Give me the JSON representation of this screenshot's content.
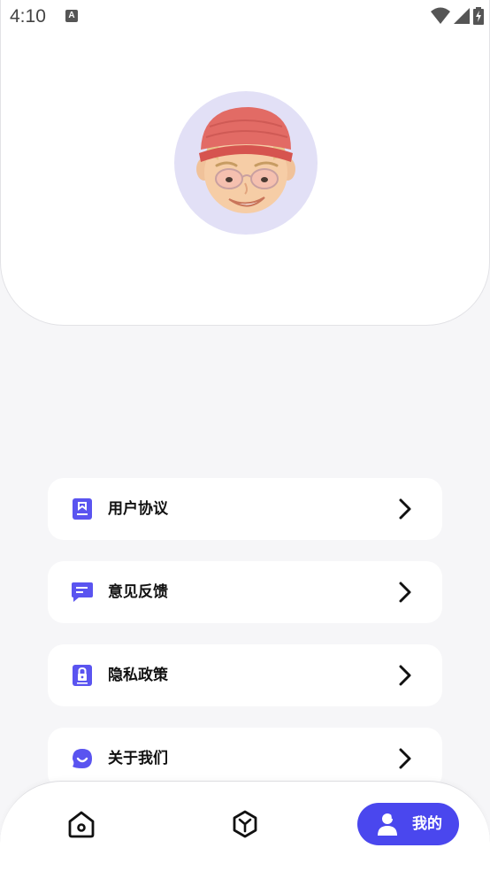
{
  "status_bar": {
    "time": "4:10",
    "notification_letter": "A"
  },
  "menu": [
    {
      "label": "用户协议",
      "icon": "document-icon"
    },
    {
      "label": "意见反馈",
      "icon": "message-icon"
    },
    {
      "label": "隐私政策",
      "icon": "lock-icon"
    },
    {
      "label": "关于我们",
      "icon": "smile-icon"
    }
  ],
  "bottom_nav": {
    "active_label": "我的"
  },
  "colors": {
    "accent": "#4a47ee",
    "background": "#f6f6f8",
    "avatar_bg": "#e2e0f6"
  }
}
